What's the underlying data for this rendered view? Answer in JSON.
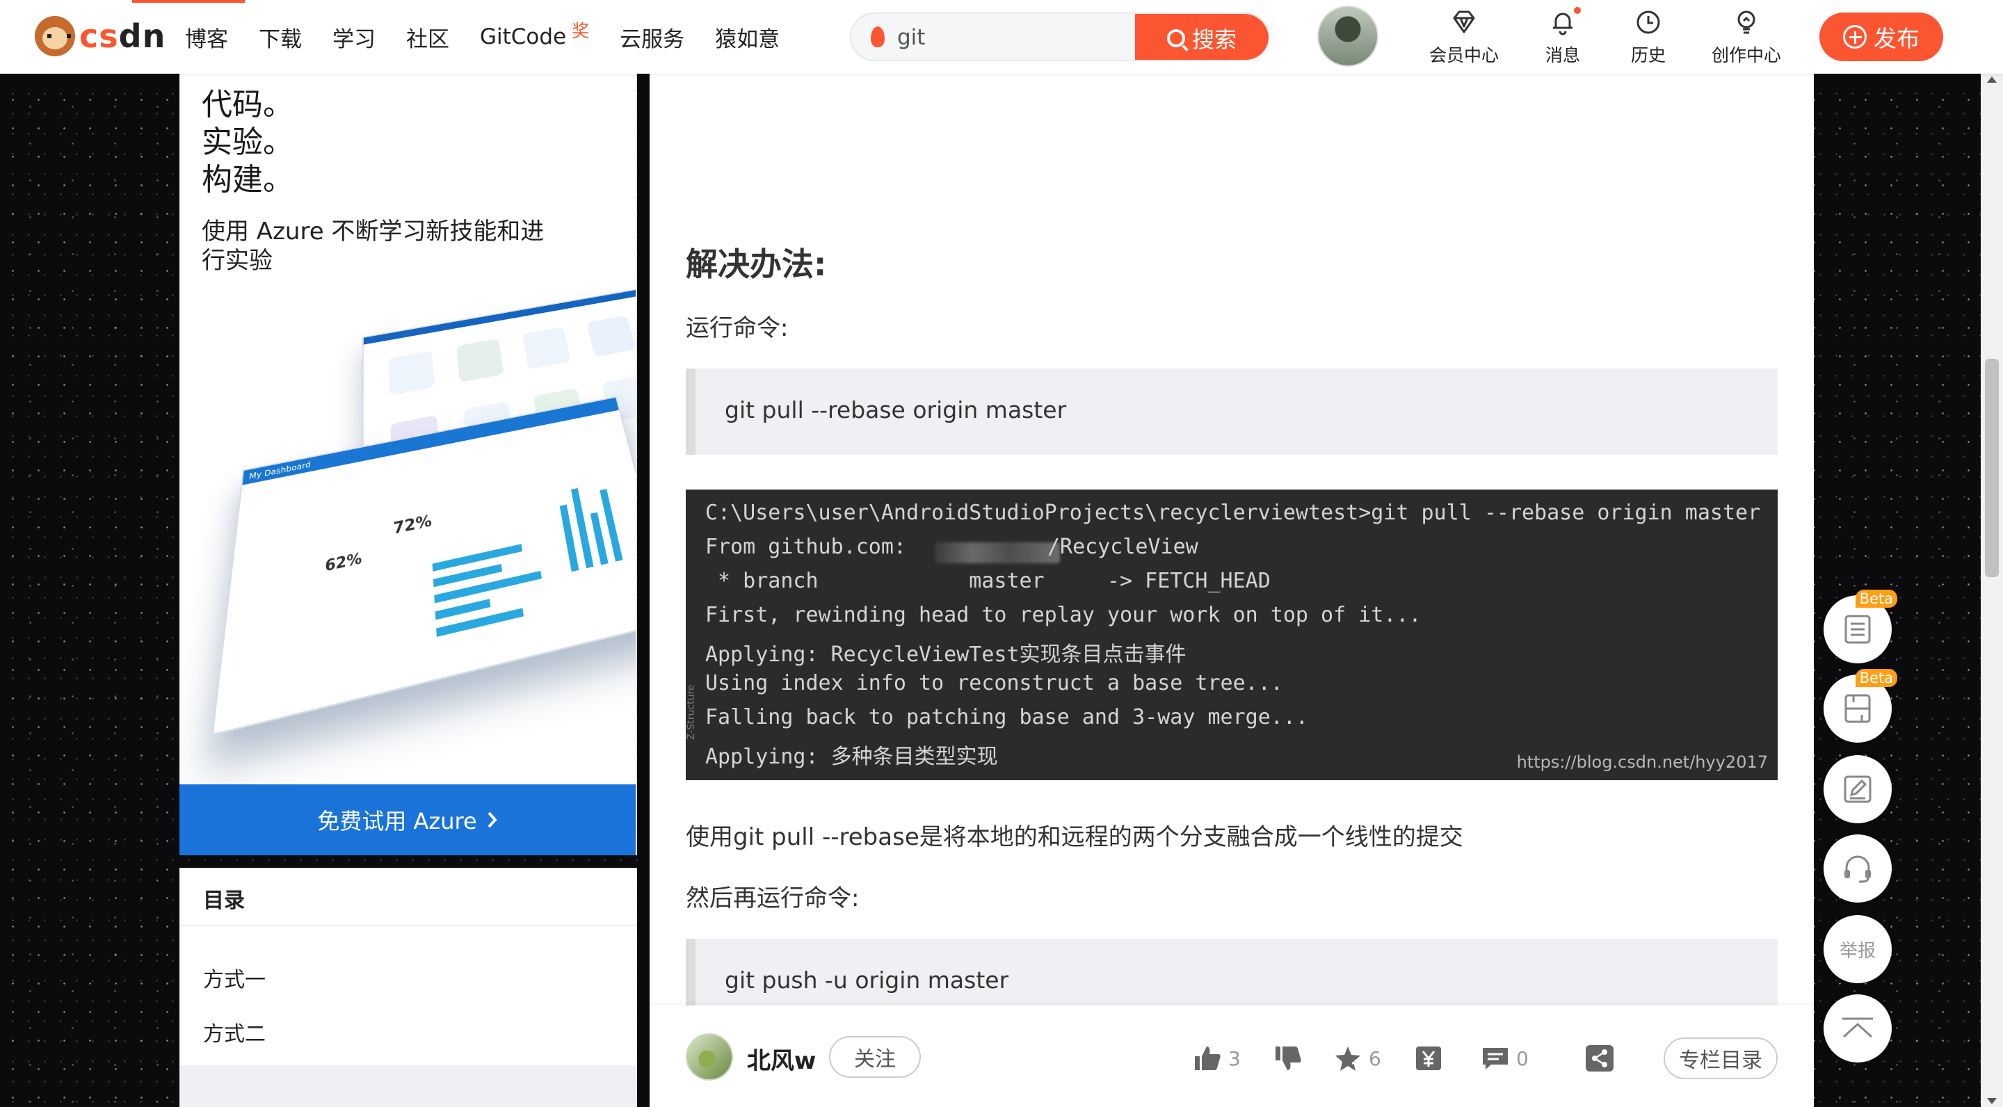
{
  "header": {
    "logo_text": "CSDN",
    "nav": [
      {
        "label": "博客"
      },
      {
        "label": "下载"
      },
      {
        "label": "学习"
      },
      {
        "label": "社区"
      },
      {
        "label": "GitCode",
        "badge": "奖"
      },
      {
        "label": "云服务"
      },
      {
        "label": "猿如意"
      }
    ],
    "search": {
      "value": "git",
      "button_label": "搜索"
    },
    "tools": [
      {
        "label": "会员中心",
        "icon": "diamond-icon"
      },
      {
        "label": "消息",
        "icon": "bell-icon"
      },
      {
        "label": "历史",
        "icon": "clock-icon"
      },
      {
        "label": "创作中心",
        "icon": "lightbulb-icon"
      }
    ],
    "publish_label": "发布",
    "accent_color": "#fc5531"
  },
  "ad": {
    "lines": [
      "代码。",
      "实验。",
      "构建。"
    ],
    "subtitle": "使用 Azure 不断学习新技能和进行实验",
    "cta": "免费试用 Azure",
    "dashboard_title": "My Dashboard",
    "stats": [
      "72%",
      "62%"
    ],
    "accent_color": "#1a73d9"
  },
  "toc": {
    "title": "目录",
    "items": [
      "方式一",
      "方式二"
    ]
  },
  "article": {
    "heading": "解决办法:",
    "p1": "运行命令:",
    "code1": "git pull --rebase origin master",
    "terminal_lines": [
      "C:\\Users\\user\\AndroidStudioProjects\\recyclerviewtest>git pull --rebase origin master",
      "From github.com:",
      "/RecycleView",
      " * branch            master     -> FETCH_HEAD",
      "First, rewinding head to replay your work on top of it...",
      "Applying: RecycleViewTest实现条目点击事件",
      "Using index info to reconstruct a base tree...",
      "Falling back to patching base and 3-way merge...",
      "Applying: 多种条目类型实现"
    ],
    "terminal_side_label": "Z-Structure",
    "watermark": "https://blog.csdn.net/hyy2017",
    "p2": "使用git pull --rebase是将本地的和远程的两个分支融合成一个线性的提交",
    "p3": "然后再运行命令:",
    "code2": "git push -u origin master"
  },
  "bottom": {
    "author": "北风w",
    "follow_label": "关注",
    "likes": "3",
    "favorites": "6",
    "comments": "0",
    "column_label": "专栏目录"
  },
  "float": {
    "beta": "Beta",
    "report": "举报"
  }
}
